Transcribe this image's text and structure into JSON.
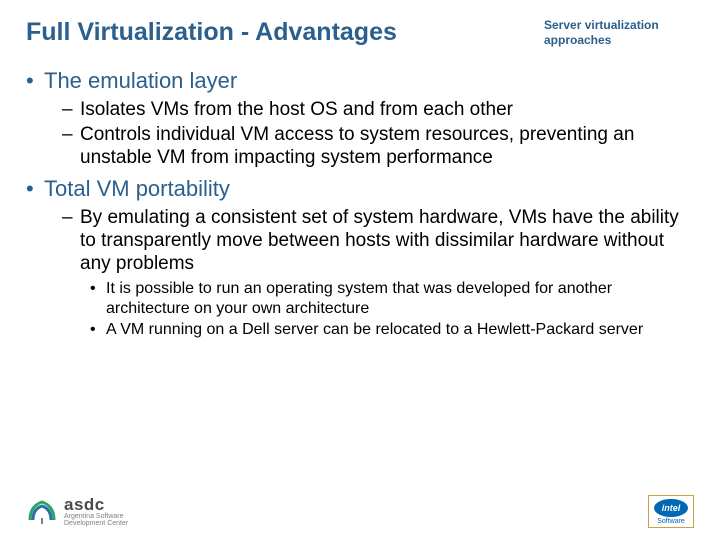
{
  "header": {
    "title": "Full Virtualization - Advantages",
    "subtitle": "Server virtualization approaches"
  },
  "bullets": {
    "b1": {
      "text": "The emulation layer"
    },
    "b1_subs": {
      "s1": "Isolates VMs from the host OS and from each other",
      "s2": "Controls individual VM access to system resources, preventing an unstable VM from impacting system performance"
    },
    "b2": {
      "text": "Total VM portability"
    },
    "b2_subs": {
      "s1": "By emulating a consistent set of system hardware, VMs have the ability to transparently move between hosts with dissimilar hardware without any problems"
    },
    "b2_subsubs": {
      "ss1": "It is possible to run an operating system that was developed for another architecture on your own architecture",
      "ss2": "A VM running on a Dell server can be relocated to a Hewlett-Packard server"
    }
  },
  "footer": {
    "asdc": {
      "main": "asdc",
      "sub1": "Argentina Software",
      "sub2": "Development Center"
    },
    "intel": {
      "brand": "intel",
      "sub": "Software"
    }
  }
}
